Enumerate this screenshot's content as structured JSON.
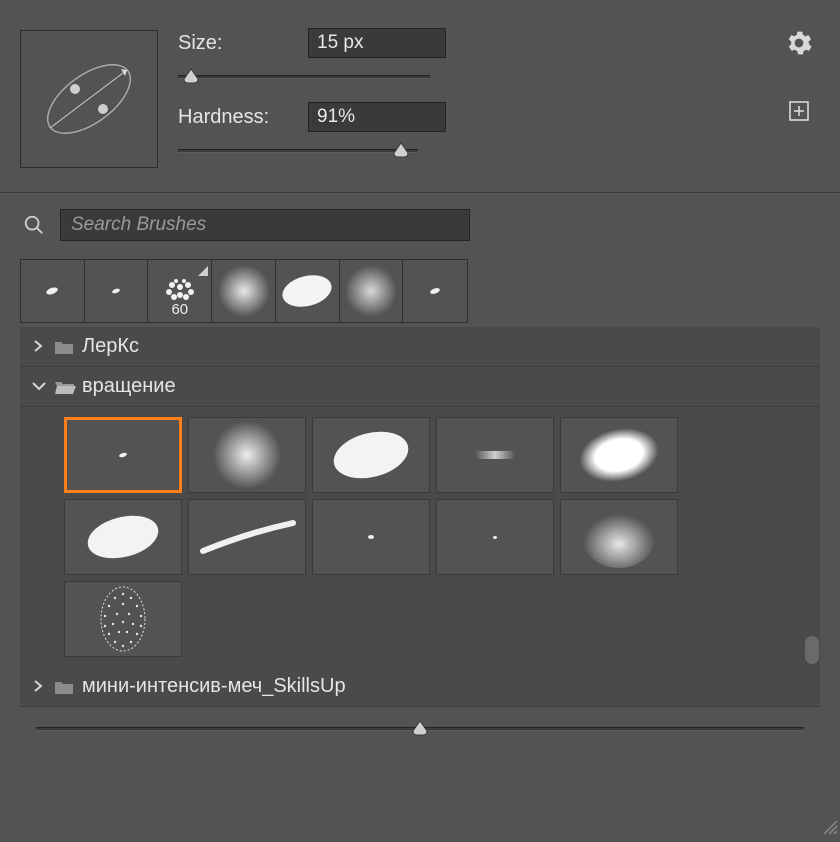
{
  "controls": {
    "size_label": "Size:",
    "size_value": "15 px",
    "hardness_label": "Hardness:",
    "hardness_value": "91%"
  },
  "search": {
    "placeholder": "Search Brushes"
  },
  "recent": {
    "items": [
      {
        "label": ""
      },
      {
        "label": ""
      },
      {
        "label": "60"
      },
      {
        "label": ""
      },
      {
        "label": ""
      },
      {
        "label": ""
      },
      {
        "label": ""
      }
    ]
  },
  "folders": {
    "top_partial": "ЛерКс",
    "expanded": "вращение",
    "bottom": "мини-интенсив-меч_SkillsUp"
  },
  "icons": {
    "gear": "gear-icon",
    "newdoc": "new-document-icon",
    "search": "search-icon"
  },
  "colors": {
    "selected_border": "#ff7f1a"
  }
}
